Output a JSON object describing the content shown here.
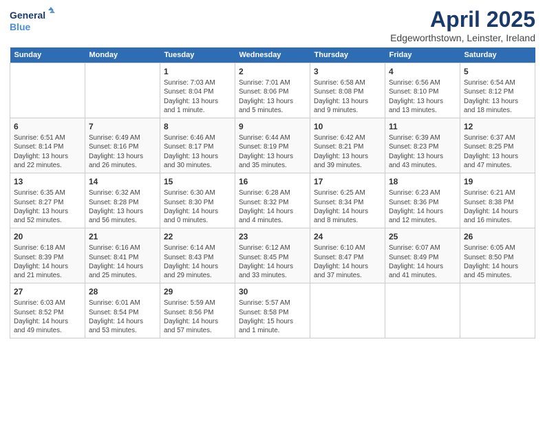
{
  "header": {
    "logo_line1": "General",
    "logo_line2": "Blue",
    "title": "April 2025",
    "subtitle": "Edgeworthstown, Leinster, Ireland"
  },
  "days_of_week": [
    "Sunday",
    "Monday",
    "Tuesday",
    "Wednesday",
    "Thursday",
    "Friday",
    "Saturday"
  ],
  "weeks": [
    [
      {
        "day": "",
        "text": ""
      },
      {
        "day": "",
        "text": ""
      },
      {
        "day": "1",
        "text": "Sunrise: 7:03 AM\nSunset: 8:04 PM\nDaylight: 13 hours and 1 minute."
      },
      {
        "day": "2",
        "text": "Sunrise: 7:01 AM\nSunset: 8:06 PM\nDaylight: 13 hours and 5 minutes."
      },
      {
        "day": "3",
        "text": "Sunrise: 6:58 AM\nSunset: 8:08 PM\nDaylight: 13 hours and 9 minutes."
      },
      {
        "day": "4",
        "text": "Sunrise: 6:56 AM\nSunset: 8:10 PM\nDaylight: 13 hours and 13 minutes."
      },
      {
        "day": "5",
        "text": "Sunrise: 6:54 AM\nSunset: 8:12 PM\nDaylight: 13 hours and 18 minutes."
      }
    ],
    [
      {
        "day": "6",
        "text": "Sunrise: 6:51 AM\nSunset: 8:14 PM\nDaylight: 13 hours and 22 minutes."
      },
      {
        "day": "7",
        "text": "Sunrise: 6:49 AM\nSunset: 8:16 PM\nDaylight: 13 hours and 26 minutes."
      },
      {
        "day": "8",
        "text": "Sunrise: 6:46 AM\nSunset: 8:17 PM\nDaylight: 13 hours and 30 minutes."
      },
      {
        "day": "9",
        "text": "Sunrise: 6:44 AM\nSunset: 8:19 PM\nDaylight: 13 hours and 35 minutes."
      },
      {
        "day": "10",
        "text": "Sunrise: 6:42 AM\nSunset: 8:21 PM\nDaylight: 13 hours and 39 minutes."
      },
      {
        "day": "11",
        "text": "Sunrise: 6:39 AM\nSunset: 8:23 PM\nDaylight: 13 hours and 43 minutes."
      },
      {
        "day": "12",
        "text": "Sunrise: 6:37 AM\nSunset: 8:25 PM\nDaylight: 13 hours and 47 minutes."
      }
    ],
    [
      {
        "day": "13",
        "text": "Sunrise: 6:35 AM\nSunset: 8:27 PM\nDaylight: 13 hours and 52 minutes."
      },
      {
        "day": "14",
        "text": "Sunrise: 6:32 AM\nSunset: 8:28 PM\nDaylight: 13 hours and 56 minutes."
      },
      {
        "day": "15",
        "text": "Sunrise: 6:30 AM\nSunset: 8:30 PM\nDaylight: 14 hours and 0 minutes."
      },
      {
        "day": "16",
        "text": "Sunrise: 6:28 AM\nSunset: 8:32 PM\nDaylight: 14 hours and 4 minutes."
      },
      {
        "day": "17",
        "text": "Sunrise: 6:25 AM\nSunset: 8:34 PM\nDaylight: 14 hours and 8 minutes."
      },
      {
        "day": "18",
        "text": "Sunrise: 6:23 AM\nSunset: 8:36 PM\nDaylight: 14 hours and 12 minutes."
      },
      {
        "day": "19",
        "text": "Sunrise: 6:21 AM\nSunset: 8:38 PM\nDaylight: 14 hours and 16 minutes."
      }
    ],
    [
      {
        "day": "20",
        "text": "Sunrise: 6:18 AM\nSunset: 8:39 PM\nDaylight: 14 hours and 21 minutes."
      },
      {
        "day": "21",
        "text": "Sunrise: 6:16 AM\nSunset: 8:41 PM\nDaylight: 14 hours and 25 minutes."
      },
      {
        "day": "22",
        "text": "Sunrise: 6:14 AM\nSunset: 8:43 PM\nDaylight: 14 hours and 29 minutes."
      },
      {
        "day": "23",
        "text": "Sunrise: 6:12 AM\nSunset: 8:45 PM\nDaylight: 14 hours and 33 minutes."
      },
      {
        "day": "24",
        "text": "Sunrise: 6:10 AM\nSunset: 8:47 PM\nDaylight: 14 hours and 37 minutes."
      },
      {
        "day": "25",
        "text": "Sunrise: 6:07 AM\nSunset: 8:49 PM\nDaylight: 14 hours and 41 minutes."
      },
      {
        "day": "26",
        "text": "Sunrise: 6:05 AM\nSunset: 8:50 PM\nDaylight: 14 hours and 45 minutes."
      }
    ],
    [
      {
        "day": "27",
        "text": "Sunrise: 6:03 AM\nSunset: 8:52 PM\nDaylight: 14 hours and 49 minutes."
      },
      {
        "day": "28",
        "text": "Sunrise: 6:01 AM\nSunset: 8:54 PM\nDaylight: 14 hours and 53 minutes."
      },
      {
        "day": "29",
        "text": "Sunrise: 5:59 AM\nSunset: 8:56 PM\nDaylight: 14 hours and 57 minutes."
      },
      {
        "day": "30",
        "text": "Sunrise: 5:57 AM\nSunset: 8:58 PM\nDaylight: 15 hours and 1 minute."
      },
      {
        "day": "",
        "text": ""
      },
      {
        "day": "",
        "text": ""
      },
      {
        "day": "",
        "text": ""
      }
    ]
  ]
}
